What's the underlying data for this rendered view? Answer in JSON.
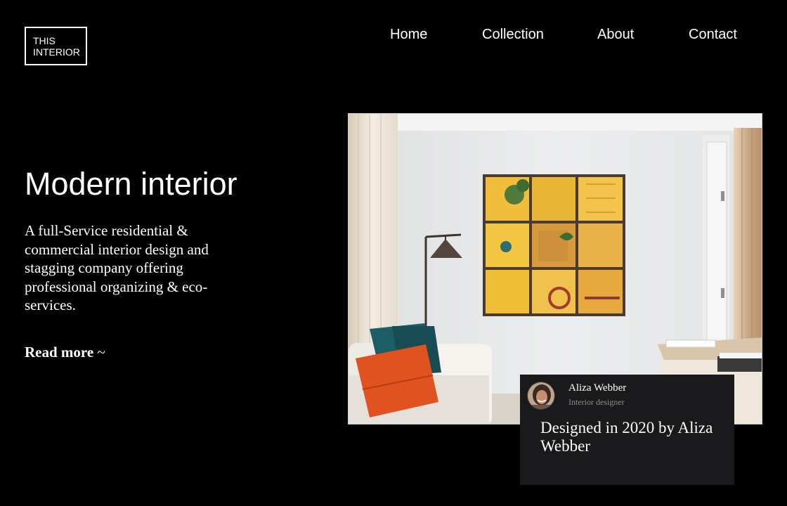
{
  "logo": {
    "line1": "THIS",
    "line2": "INTERIOR"
  },
  "nav": {
    "items": [
      {
        "label": "Home"
      },
      {
        "label": "Collection"
      },
      {
        "label": "About"
      },
      {
        "label": "Contact"
      }
    ]
  },
  "hero": {
    "title": "Modern interior",
    "description": "A full-Service residential & commercial interior design and stagging company offering professional organizing & eco-services.",
    "cta_label": "Read more",
    "cta_suffix": "~"
  },
  "designer_card": {
    "name": "Aliza Webber",
    "role": "Interior designer",
    "quote": "Designed in 2020 by Aliza Webber"
  },
  "colors": {
    "background": "#000000",
    "text": "#ffffff",
    "card_background": "#1a1a1c",
    "muted_text": "#8e8e8e",
    "accent_yellow": "#f2c232",
    "accent_orange": "#e0521f",
    "accent_teal": "#1c5d66"
  },
  "icons": {
    "avatar": "designer-avatar-photo"
  }
}
